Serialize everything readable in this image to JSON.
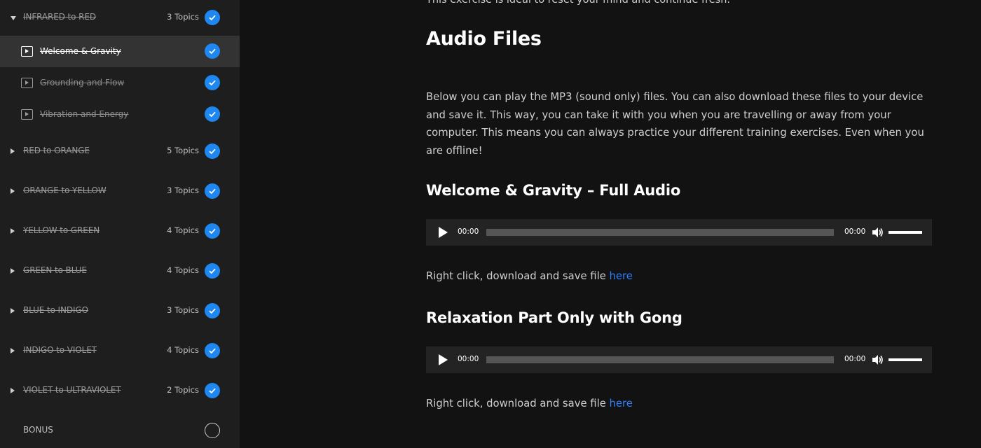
{
  "sidebar": {
    "sections": [
      {
        "label": "INFRARED to RED",
        "count": "3 Topics",
        "expanded": true,
        "completed": true
      },
      {
        "label": "RED to ORANGE",
        "count": "5 Topics",
        "expanded": false,
        "completed": true
      },
      {
        "label": "ORANGE to YELLOW",
        "count": "3 Topics",
        "expanded": false,
        "completed": true
      },
      {
        "label": "YELLOW to GREEN",
        "count": "4 Topics",
        "expanded": false,
        "completed": true
      },
      {
        "label": "GREEN to BLUE",
        "count": "4 Topics",
        "expanded": false,
        "completed": true
      },
      {
        "label": "BLUE to INDIGO",
        "count": "3 Topics",
        "expanded": false,
        "completed": true
      },
      {
        "label": "INDIGO to VIOLET",
        "count": "4 Topics",
        "expanded": false,
        "completed": true
      },
      {
        "label": "VIOLET to ULTRAVIOLET",
        "count": "2 Topics",
        "expanded": false,
        "completed": true
      }
    ],
    "topics": [
      {
        "label": "Welcome & Gravity",
        "active": true,
        "completed": true
      },
      {
        "label": "Grounding and Flow",
        "active": false,
        "completed": true
      },
      {
        "label": "Vibration and Energy",
        "active": false,
        "completed": true
      }
    ],
    "bonus": {
      "label": "BONUS",
      "completed": false
    }
  },
  "main": {
    "cut_text": "This exercise is ideal to reset your mind and continue fresh.",
    "title": "Audio Files",
    "intro": "Below you can play the MP3 (sound only) files. You can also download these files to your device and save it. This way, you can take it with you when you are travelling or away from your computer. This means you can always practice your different training exercises. Even when you are offline!",
    "audio": [
      {
        "heading": "Welcome & Gravity – Full Audio",
        "current_time": "00:00",
        "duration": "00:00",
        "download_text": "Right click, download and save file ",
        "link_text": "here"
      },
      {
        "heading": "Relaxation Part Only with Gong",
        "current_time": "00:00",
        "duration": "00:00",
        "download_text": "Right click, download and save file ",
        "link_text": "here"
      }
    ]
  },
  "colors": {
    "accent": "#1e88f0",
    "link": "#2f80ff",
    "sidebar_bg": "#1e1e1e",
    "active_bg": "#333333",
    "page_bg": "#121212"
  }
}
